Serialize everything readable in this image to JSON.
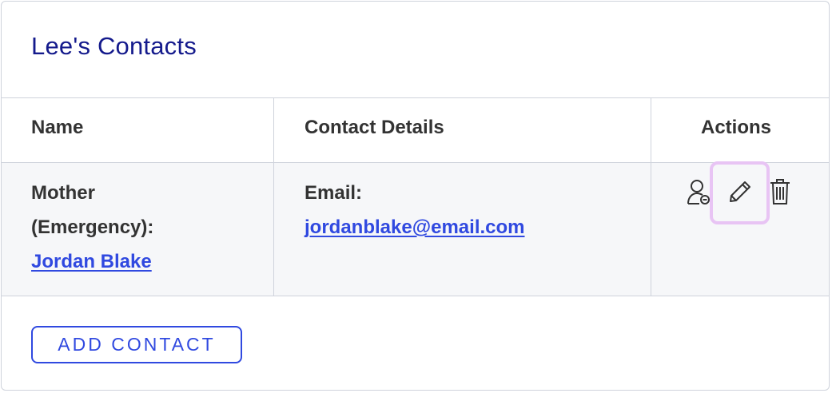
{
  "card": {
    "title": "Lee's Contacts"
  },
  "table": {
    "headers": {
      "name": "Name",
      "details": "Contact Details",
      "actions": "Actions"
    },
    "rows": [
      {
        "relation_line1": "Mother",
        "relation_line2": "(Emergency):",
        "name_link": "Jordan Blake",
        "detail_label": "Email:",
        "detail_value": "jordanblake@email.com",
        "actions": [
          "person-icon",
          "pencil-icon",
          "trash-icon"
        ]
      }
    ]
  },
  "footer": {
    "add_button_label": "ADD CONTACT"
  },
  "colors": {
    "title": "#141a8c",
    "link": "#3049e0",
    "highlight": "#e8c4f4",
    "row_bg": "#f6f7f9",
    "border": "#cfd3dc"
  }
}
